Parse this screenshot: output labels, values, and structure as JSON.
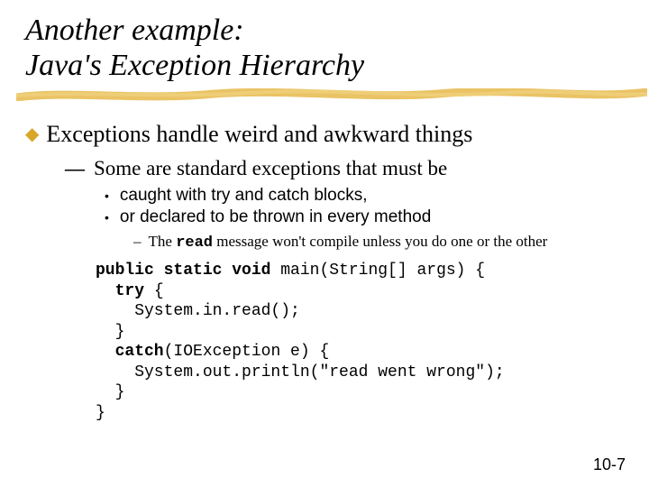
{
  "title_line1": "Another example:",
  "title_line2": "Java's Exception Hierarchy",
  "lvl1_text": "Exceptions handle weird and awkward things",
  "lvl2_text": "Some are standard exceptions that must be",
  "lvl3_items": [
    "caught with try and catch blocks,",
    "or declared to be thrown in every method"
  ],
  "lvl4_prefix": "The ",
  "lvl4_mono": "read",
  "lvl4_suffix": " message won't compile unless you do one or the other",
  "code": {
    "l1a": "public static void",
    "l1b": " main(String[] args) {",
    "l2a": "  try",
    "l2b": " {",
    "l3": "    System.in.read();",
    "l4": "  }",
    "l5a": "  catch",
    "l5b": "(IOException e) {",
    "l6": "    System.out.println(\"read went wrong\");",
    "l7": "  }",
    "l8": "}"
  },
  "page_number": "10-7",
  "bullets": {
    "diamond": "◆",
    "em": "—",
    "dot": "•",
    "dash": "–"
  }
}
